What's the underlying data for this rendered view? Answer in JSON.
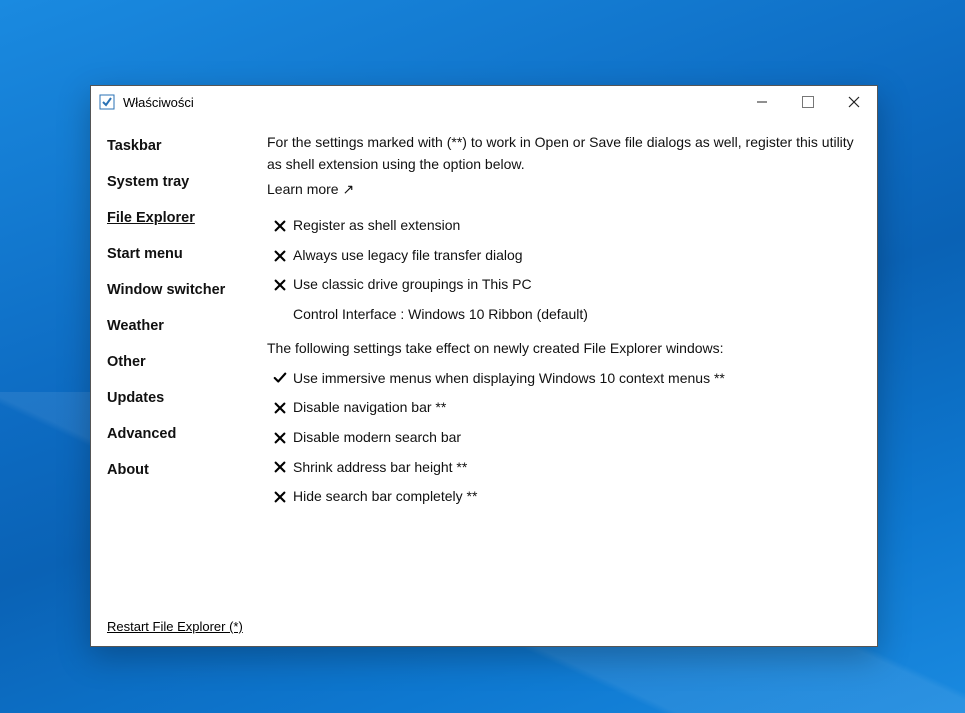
{
  "window": {
    "title": "Właściwości"
  },
  "sidebar": {
    "items": [
      {
        "label": "Taskbar"
      },
      {
        "label": "System tray"
      },
      {
        "label": "File Explorer",
        "selected": true
      },
      {
        "label": "Start menu"
      },
      {
        "label": "Window switcher"
      },
      {
        "label": "Weather"
      },
      {
        "label": "Other"
      },
      {
        "label": "Updates"
      },
      {
        "label": "Advanced"
      },
      {
        "label": "About"
      }
    ],
    "restart": "Restart File Explorer (*)"
  },
  "content": {
    "intro": "For the settings marked with (**) to work in Open or Save file dialogs as well, register this utility as shell extension using the option below.",
    "learn_more": "Learn more ↗",
    "group1": [
      {
        "state": "off",
        "label": "Register as shell extension"
      },
      {
        "state": "off",
        "label": "Always use legacy file transfer dialog"
      },
      {
        "state": "off",
        "label": "Use classic drive groupings in This PC"
      },
      {
        "state": "none",
        "label": "Control Interface : Windows 10 Ribbon (default)"
      }
    ],
    "section2_title": "The following settings take effect on newly created File Explorer windows:",
    "group2": [
      {
        "state": "on",
        "label": "Use immersive menus when displaying Windows 10 context menus **"
      },
      {
        "state": "off",
        "label": "Disable navigation bar **"
      },
      {
        "state": "off",
        "label": "Disable modern search bar"
      },
      {
        "state": "off",
        "label": "Shrink address bar height **"
      },
      {
        "state": "off",
        "label": "Hide search bar completely **"
      }
    ]
  }
}
